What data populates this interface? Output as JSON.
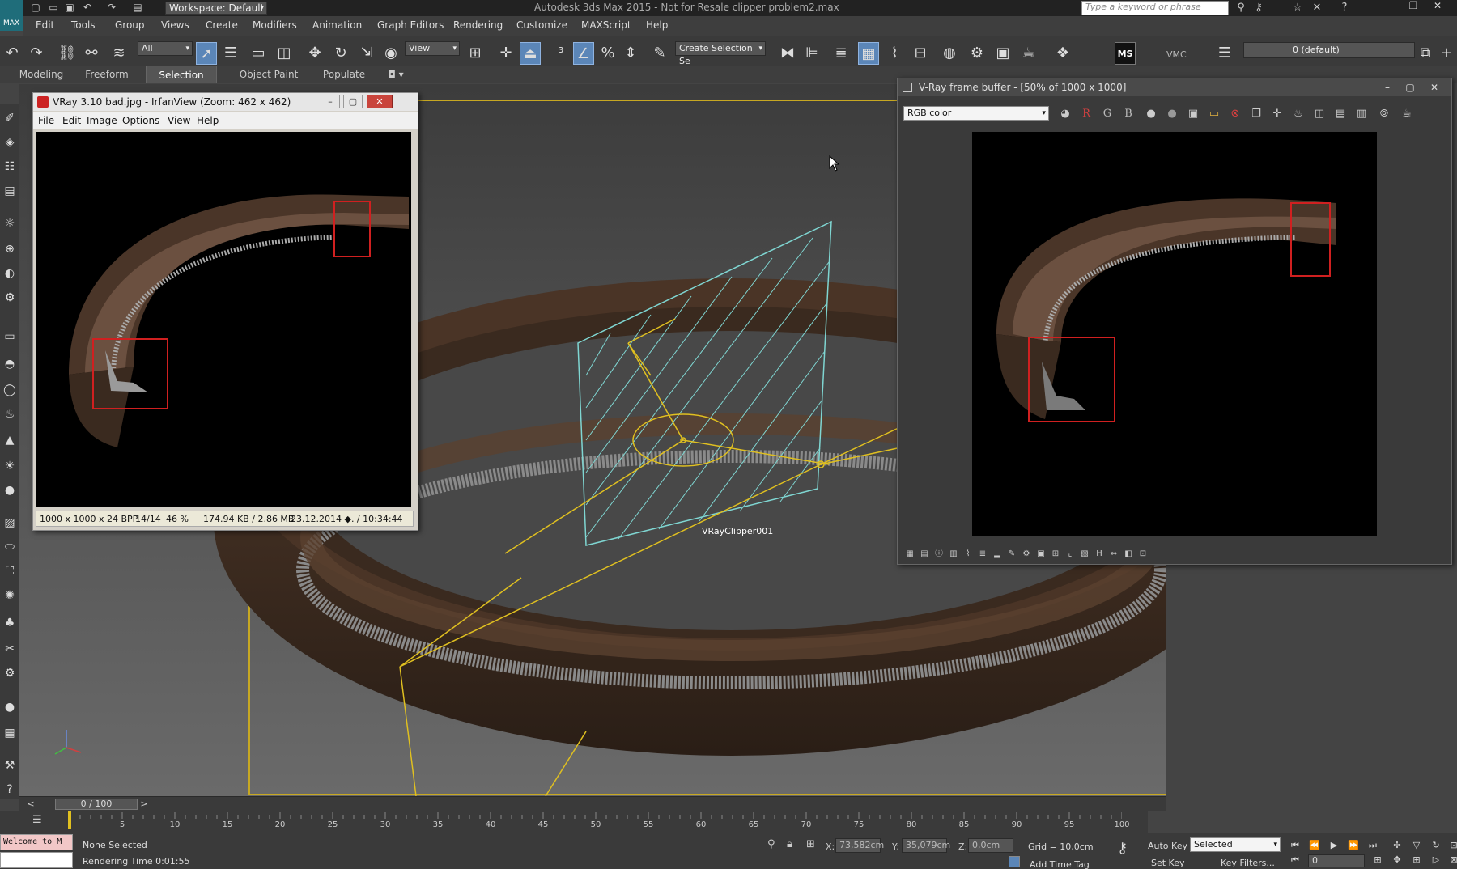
{
  "titlebar": {
    "workspace": "Workspace: Default",
    "app_title": "Autodesk 3ds Max  2015  - Not for Resale    clipper problem2.max",
    "search_placeholder": "Type a keyword or phrase",
    "logo_label": "MAX"
  },
  "menu": [
    "Edit",
    "Tools",
    "Group",
    "Views",
    "Create",
    "Modifiers",
    "Animation",
    "Graph Editors",
    "Rendering",
    "Customize",
    "MAXScript",
    "Help"
  ],
  "toolbar": {
    "filter_select": "All",
    "ref_coord_select": "View",
    "selection_set": "Create Selection Se",
    "vmc_label": "VMC",
    "ms_label": "MS",
    "layer_select": "0 (default)"
  },
  "ribbon": {
    "tabs": [
      "Modeling",
      "Freeform",
      "Selection",
      "Object Paint",
      "Populate"
    ],
    "active_tab": "Selection"
  },
  "viewport": {
    "object_label": "VRayClipper001"
  },
  "irfanview": {
    "title": "VRay 3.10 bad.jpg - IrfanView (Zoom: 462 x 462)",
    "menu": [
      "File",
      "Edit",
      "Image",
      "Options",
      "View",
      "Help"
    ],
    "status": {
      "size": "1000 x 1000 x 24 BPP",
      "index": "14/14",
      "zoom": "46 %",
      "filesize": "174.94 KB / 2.86 MB",
      "datetime": "23.12.2014 ◆. / 10:34:44"
    }
  },
  "vfb": {
    "title": "V-Ray frame buffer - [50% of 1000 x 1000]",
    "channel": "RGB color",
    "r": "R",
    "g": "G",
    "b": "B"
  },
  "timeline": {
    "frame_indicator": "0 / 100",
    "ticks": [
      "5",
      "10",
      "15",
      "20",
      "25",
      "30",
      "35",
      "40",
      "45",
      "50",
      "55",
      "60",
      "65",
      "70",
      "75",
      "80",
      "85",
      "90",
      "95",
      "100"
    ]
  },
  "statusbar": {
    "listener_top": "Welcome to M",
    "selection": "None Selected",
    "render_time": "Rendering Time  0:01:55",
    "x_label": "X:",
    "x_value": "73,582cm",
    "y_label": "Y:",
    "y_value": "35,079cm",
    "z_label": "Z:",
    "z_value": "0,0cm",
    "grid": "Grid = 10,0cm",
    "add_time_tag": "Add Time Tag",
    "auto_key": "Auto Key",
    "set_key": "Set Key",
    "selected": "Selected",
    "key_filters": "Key Filters...",
    "frame": "0"
  },
  "colors": {
    "accent_blue": "#5b86b8",
    "viewport_bg": "#565656",
    "clipper_cyan": "#7fd6d2",
    "helper_yellow": "#e0c020",
    "highlight_red": "#d02020",
    "seal_brown": "#4a3426"
  }
}
